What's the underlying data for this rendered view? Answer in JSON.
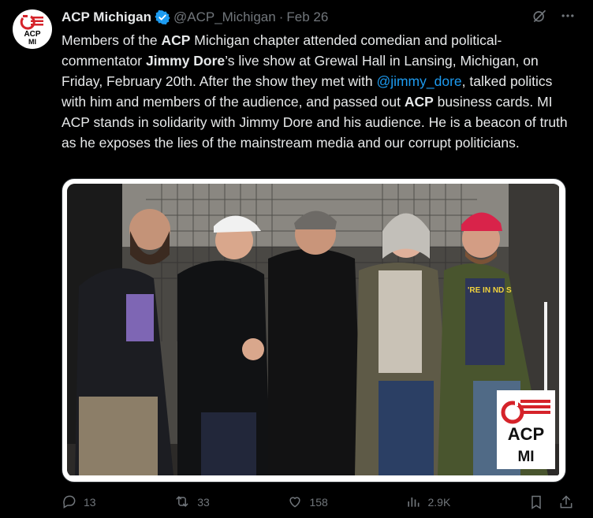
{
  "author": {
    "name": "ACP Michigan",
    "handle": "@ACP_Michigan",
    "separator": "·",
    "date": "Feb 26",
    "avatar_text_top": "ACP",
    "avatar_text_bottom": "MI"
  },
  "tweet": {
    "t1": "Members of the ",
    "b1": "ACP",
    "t2": " Michigan chapter attended comedian and political-commentator ",
    "b2": "Jimmy Dore",
    "t3": "’s live show at Grewal Hall in Lansing, Michigan, on Friday, February 20th. After the show they met with ",
    "mention": "@jimmy_dore",
    "t4": ", talked politics with him and members of the audience, and passed out ",
    "b3": "ACP",
    "t5": " business cards. MI ACP stands in solidarity with Jimmy Dore and his audience. He is a beacon of truth as he exposes the lies of the mainstream media and our corrupt politicians."
  },
  "media": {
    "logo_top": "ACP",
    "logo_bottom": "MI",
    "shirt_text": "'RE IN ND S"
  },
  "actions": {
    "replies": "13",
    "reposts": "33",
    "likes": "158",
    "views": "2.9K"
  },
  "colors": {
    "background": "#000000",
    "text": "#e7e9ea",
    "muted": "#71767b",
    "accent": "#1d9bf0",
    "brand_red": "#d5232a"
  },
  "icons": [
    "verified-badge-icon",
    "grok-icon",
    "more-icon",
    "reply-icon",
    "repost-icon",
    "like-icon",
    "views-icon",
    "bookmark-icon",
    "share-icon"
  ]
}
